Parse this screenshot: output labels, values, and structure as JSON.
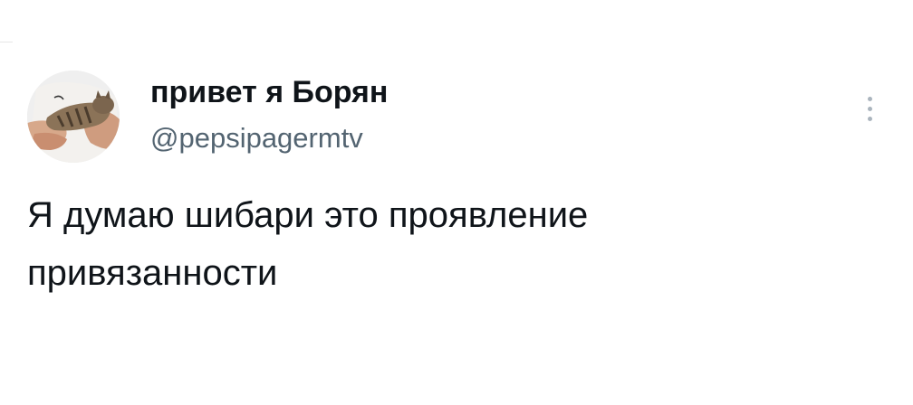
{
  "tweet": {
    "display_name": "привет я Борян",
    "handle": "@pepsipagermtv",
    "text": "Я думаю шибари это проявление привязанности"
  },
  "icons": {
    "avatar": "avatar-photo",
    "more": "more-vertical-icon"
  },
  "colors": {
    "name": "#0f1419",
    "handle": "#536471",
    "text": "#0f1419",
    "more_dots": "#aab4bd",
    "background": "#ffffff"
  }
}
